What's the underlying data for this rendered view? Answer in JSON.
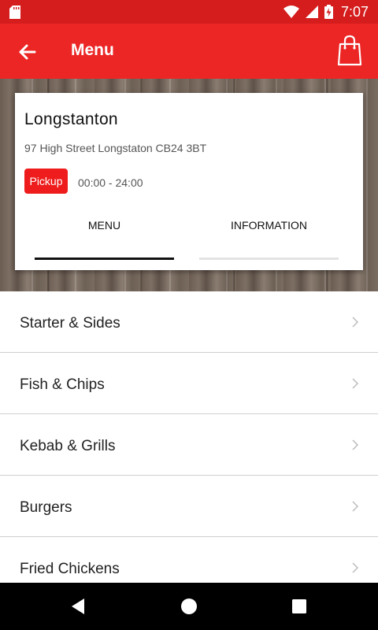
{
  "status_bar": {
    "time": "7:07",
    "battery_level": "charging"
  },
  "app_bar": {
    "title": "Menu"
  },
  "store": {
    "name": "Longstanton",
    "address": "97 High Street Longstaton CB24 3BT",
    "mode_badge": "Pickup",
    "hours": "00:00 - 24:00"
  },
  "tabs": [
    {
      "label": "MENU",
      "active": true
    },
    {
      "label": "INFORMATION",
      "active": false
    }
  ],
  "categories": [
    {
      "label": "Starter & Sides"
    },
    {
      "label": "Fish & Chips"
    },
    {
      "label": "Kebab & Grills"
    },
    {
      "label": "Burgers"
    },
    {
      "label": "Fried Chickens"
    }
  ],
  "colors": {
    "status_bar": "#d51d1d",
    "app_bar": "#ec2525",
    "accent": "#ee1c1c"
  },
  "icons": {
    "back": "arrow-left-icon",
    "cart": "shopping-bag-icon",
    "chevron": "chevron-right-icon"
  }
}
